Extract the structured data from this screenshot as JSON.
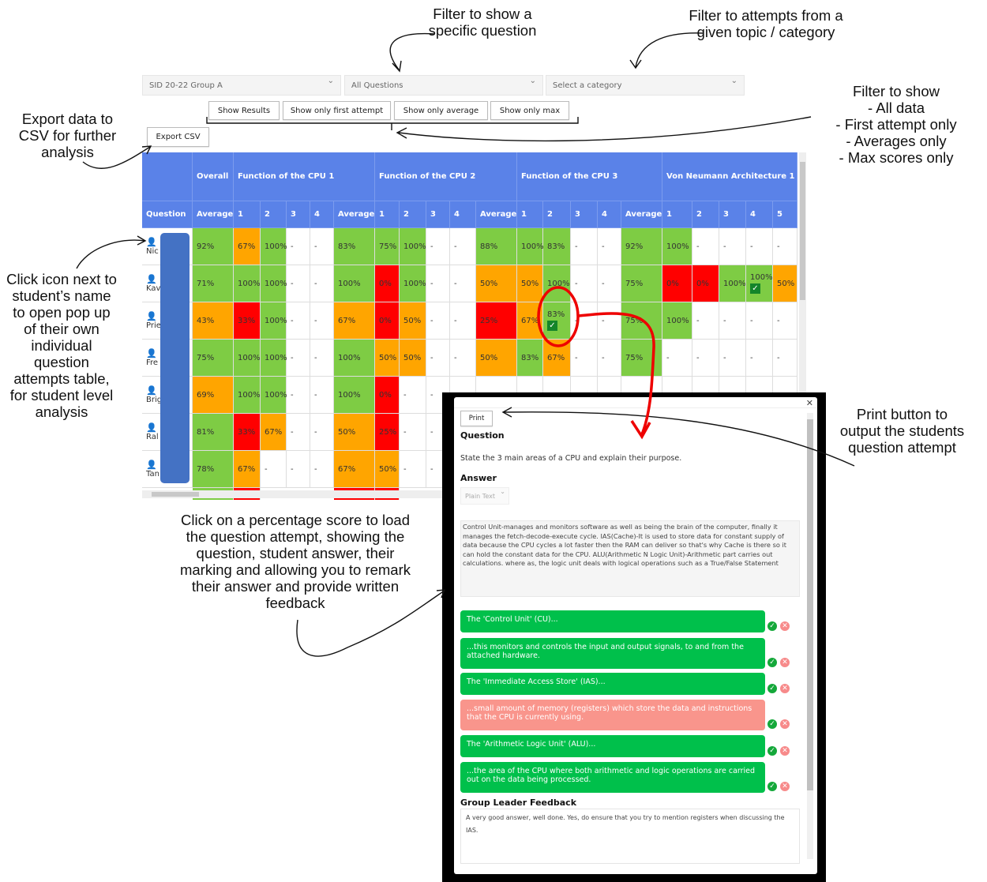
{
  "annotations": {
    "question_filter": "Filter to show a specific question",
    "category_filter": "Filter to attempts from a given topic / category",
    "view_filter_title": "Filter to show",
    "view_filter_items": [
      "-  All data",
      "-  First attempt only",
      "-  Averages only",
      "-  Max scores only"
    ],
    "export": "Export data to CSV for further analysis",
    "student_icon": "Click icon next to student’s name to open pop up of their own individual question attempts table, for student level analysis",
    "score_click": "Click on a percentage score to load the question attempt, showing the question, student answer, their marking and allowing you to remark their answer and provide written feedback",
    "print": "Print button to output the students question attempt"
  },
  "filters": {
    "group": "SID 20-22 Group A",
    "question": "All Questions",
    "category_placeholder": "Select a category"
  },
  "buttons": {
    "show_results": "Show Results",
    "first_attempt": "Show only first attempt",
    "average": "Show only average",
    "max": "Show only max",
    "export": "Export CSV"
  },
  "table": {
    "groups": [
      "Overall",
      "Function of the CPU 1",
      "Function of the CPU 2",
      "Function of the CPU 3",
      "Von Neumann Architecture 1"
    ],
    "columns": [
      "Question",
      "Average",
      "1",
      "2",
      "3",
      "4",
      "Average",
      "1",
      "2",
      "3",
      "4",
      "Average",
      "1",
      "2",
      "3",
      "4",
      "Average",
      "1",
      "2",
      "3",
      "4",
      "5"
    ],
    "rows": [
      {
        "name": "Nic",
        "cells": [
          "92%",
          "67%",
          "100%",
          "-",
          "-",
          "83%",
          "75%",
          "100%",
          "-",
          "-",
          "88%",
          "100%",
          "83%",
          "-",
          "-",
          "92%",
          "100%",
          "-",
          "-",
          "-",
          "-"
        ]
      },
      {
        "name": "Kav",
        "cells": [
          "71%",
          "100%",
          "100%",
          "-",
          "-",
          "100%",
          "0%",
          "100%",
          "-",
          "-",
          "50%",
          "50%",
          "100%",
          "-",
          "-",
          "75%",
          "0%",
          "0%",
          "100%",
          "100%",
          "50%"
        ]
      },
      {
        "name": "Prie",
        "cells": [
          "43%",
          "33%",
          "100%",
          "-",
          "-",
          "67%",
          "0%",
          "50%",
          "-",
          "-",
          "25%",
          "67%",
          "83%",
          "-",
          "-",
          "75%",
          "100%",
          "-",
          "-",
          "-",
          "-"
        ]
      },
      {
        "name": "Fre",
        "cells": [
          "75%",
          "100%",
          "100%",
          "-",
          "-",
          "100%",
          "50%",
          "50%",
          "-",
          "-",
          "50%",
          "83%",
          "67%",
          "-",
          "-",
          "75%",
          "-",
          "-",
          "-",
          "-",
          "-"
        ]
      },
      {
        "name": "Brig",
        "cells": [
          "69%",
          "100%",
          "100%",
          "-",
          "-",
          "100%",
          "0%",
          "-",
          "-"
        ]
      },
      {
        "name": "Ral",
        "cells": [
          "81%",
          "33%",
          "67%",
          "-",
          "-",
          "50%",
          "25%",
          "-",
          "-"
        ]
      },
      {
        "name": "Tan",
        "cells": [
          "78%",
          "67%",
          "-",
          "-",
          "-",
          "67%",
          "50%",
          "-",
          "-"
        ]
      }
    ],
    "marked_cells": [
      [
        1,
        19
      ],
      [
        2,
        12
      ]
    ],
    "colors": {
      "good": "#7ecc44",
      "mid": "#ffa500",
      "poor": "#ff0000",
      "header": "#5a82e8"
    }
  },
  "popup": {
    "print": "Print",
    "question_label": "Question",
    "question": "State the 3 main areas of a CPU and explain their purpose.",
    "answer_label": "Answer",
    "format": "Plain Text",
    "answer": "Control Unit-manages and monitors software as well as being the brain of the computer, finally it manages the fetch-decode-execute cycle. IAS(Cache)-It is used to store data for constant supply of data because the CPU cycles a lot faster then the RAM can deliver so that's why Cache is there so it can hold the constant data for the CPU. ALU(Arithmetic N Logic Unit)-Arithmetic part carries out calculations. where as, the logic unit deals with logical operations such as a True/False Statement",
    "mark_points": [
      {
        "text": "The 'Control Unit' (CU)...",
        "awarded": true
      },
      {
        "text": "...this monitors and controls the input and output signals, to and from the attached hardware.",
        "awarded": true
      },
      {
        "text": "The 'Immediate Access Store' (IAS)...",
        "awarded": true
      },
      {
        "text": "...small amount of memory (registers) which store the data and instructions that the CPU is currently using.",
        "awarded": false
      },
      {
        "text": "The 'Arithmetic Logic Unit' (ALU)...",
        "awarded": true
      },
      {
        "text": "...the area of the CPU where both arithmetic and logic operations are carried out on the data being processed.",
        "awarded": true
      }
    ],
    "feedback_label": "Group Leader Feedback",
    "feedback": "A very good answer, well done. Yes, do ensure that you try to mention registers when discussing the IAS."
  }
}
